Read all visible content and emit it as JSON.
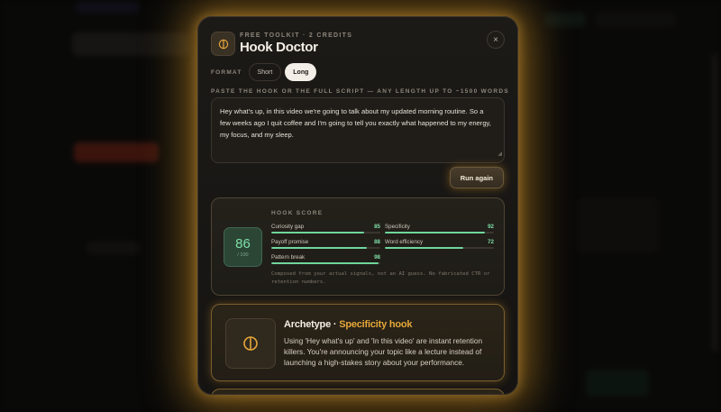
{
  "modal": {
    "eyebrow": "FREE TOOLKIT · 2 CREDITS",
    "title": "Hook Doctor",
    "close_label": "×",
    "icon": "split-circle-icon"
  },
  "format": {
    "label": "FORMAT",
    "options": [
      {
        "label": "Short",
        "selected": false
      },
      {
        "label": "Long",
        "selected": true
      }
    ]
  },
  "input": {
    "label": "PASTE THE HOOK OR THE FULL SCRIPT — ANY LENGTH UP TO ~1500 WORDS",
    "value": "Hey what's up, in this video we're going to talk about my updated morning routine. So a few weeks ago I quit coffee and I'm going to tell you exactly what happened to my energy, my focus, and my sleep."
  },
  "run_button": "Run again",
  "score": {
    "title": "HOOK SCORE",
    "value": "86",
    "max_label": "/ 100",
    "metrics": [
      {
        "label": "Curiosity gap",
        "value": 85
      },
      {
        "label": "Specificity",
        "value": 92
      },
      {
        "label": "Payoff promise",
        "value": 88
      },
      {
        "label": "Word efficiency",
        "value": 72
      },
      {
        "label": "Pattern break",
        "value": 98
      }
    ],
    "note": "Composed from your actual signals, not an AI guess. No fabricated CTR or retention numbers."
  },
  "archetype": {
    "prefix": "Archetype · ",
    "name": "Specificity hook",
    "body": "Using 'Hey what's up' and 'In this video' are instant retention killers. You're announcing your topic like a lecture instead of launching a high-stakes story about your performance.",
    "icon": "split-circle-icon"
  },
  "colors": {
    "accent": "#e6a73a",
    "score_green": "#7fe0a8",
    "bar_green": "#6fd69c",
    "glow": "#d69628"
  }
}
